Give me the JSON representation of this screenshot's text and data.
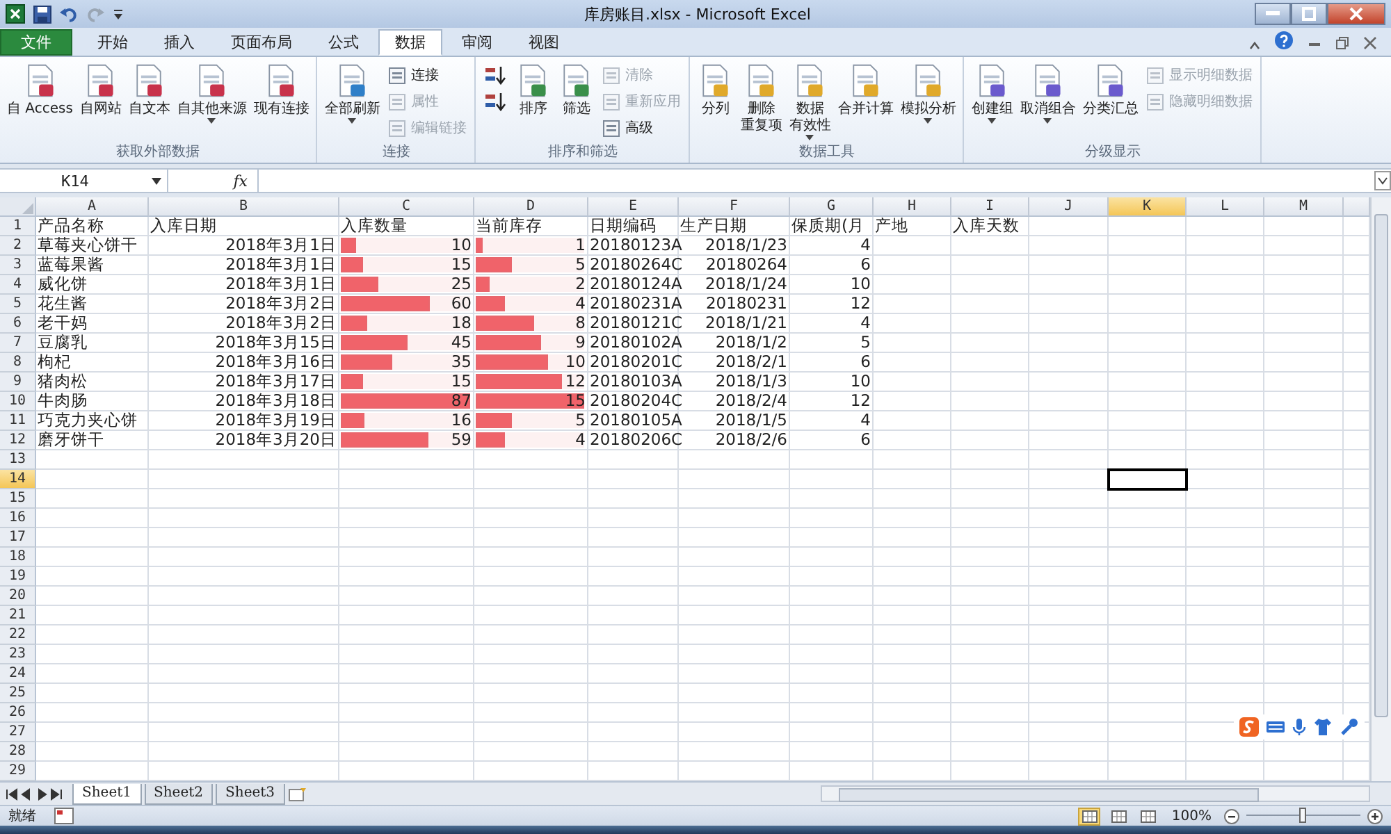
{
  "window": {
    "title": "库房账目.xlsx - Microsoft Excel"
  },
  "tabs": [
    {
      "label": "文件",
      "kind": "file",
      "selected": false
    },
    {
      "label": "开始",
      "kind": "tab",
      "selected": false
    },
    {
      "label": "插入",
      "kind": "tab",
      "selected": false
    },
    {
      "label": "页面布局",
      "kind": "tab",
      "selected": false
    },
    {
      "label": "公式",
      "kind": "tab",
      "selected": false
    },
    {
      "label": "数据",
      "kind": "tab",
      "selected": true
    },
    {
      "label": "审阅",
      "kind": "tab",
      "selected": false
    },
    {
      "label": "视图",
      "kind": "tab",
      "selected": false
    }
  ],
  "ribbon_groups": [
    {
      "label": "获取外部数据",
      "items": [
        {
          "kind": "large",
          "lines": [
            "自 Access"
          ],
          "disabled": false,
          "dropdown": false
        },
        {
          "kind": "large",
          "lines": [
            "自网站"
          ],
          "disabled": false,
          "dropdown": false
        },
        {
          "kind": "large",
          "lines": [
            "自文本"
          ],
          "disabled": false,
          "dropdown": false
        },
        {
          "kind": "large",
          "lines": [
            "自其他来源"
          ],
          "disabled": false,
          "dropdown": true
        },
        {
          "kind": "large",
          "lines": [
            "现有连接"
          ],
          "disabled": false,
          "dropdown": false
        }
      ]
    },
    {
      "label": "连接",
      "items": [
        {
          "kind": "large",
          "lines": [
            "全部刷新"
          ],
          "disabled": false,
          "dropdown": true
        },
        {
          "kind": "small",
          "lines": [
            "连接"
          ],
          "disabled": false,
          "dropdown": false
        },
        {
          "kind": "small",
          "lines": [
            "属性"
          ],
          "disabled": true,
          "dropdown": false
        },
        {
          "kind": "small",
          "lines": [
            "编辑链接"
          ],
          "disabled": true,
          "dropdown": false
        }
      ]
    },
    {
      "label": "排序和筛选",
      "items": [
        {
          "kind": "small",
          "disabled": false,
          "dropdown": false
        },
        {
          "kind": "small",
          "disabled": false,
          "dropdown": false
        },
        {
          "kind": "large",
          "lines": [
            "排序"
          ],
          "disabled": false,
          "dropdown": false
        },
        {
          "kind": "large",
          "lines": [
            "筛选"
          ],
          "disabled": false,
          "dropdown": false
        },
        {
          "kind": "small",
          "lines": [
            "清除"
          ],
          "disabled": true,
          "dropdown": false
        },
        {
          "kind": "small",
          "lines": [
            "重新应用"
          ],
          "disabled": true,
          "dropdown": false
        },
        {
          "kind": "small",
          "lines": [
            "高级"
          ],
          "disabled": false,
          "dropdown": false
        }
      ]
    },
    {
      "label": "数据工具",
      "items": [
        {
          "kind": "large",
          "lines": [
            "分列"
          ],
          "disabled": false,
          "dropdown": false
        },
        {
          "kind": "large",
          "lines": [
            "删除",
            "重复项"
          ],
          "disabled": false,
          "dropdown": false
        },
        {
          "kind": "large",
          "lines": [
            "数据",
            "有效性"
          ],
          "disabled": false,
          "dropdown": true
        },
        {
          "kind": "large",
          "lines": [
            "合并计算"
          ],
          "disabled": false,
          "dropdown": false
        },
        {
          "kind": "large",
          "lines": [
            "模拟分析"
          ],
          "disabled": false,
          "dropdown": true
        }
      ]
    },
    {
      "label": "分级显示",
      "items": [
        {
          "kind": "large",
          "lines": [
            "创建组"
          ],
          "disabled": false,
          "dropdown": true
        },
        {
          "kind": "large",
          "lines": [
            "取消组合"
          ],
          "disabled": false,
          "dropdown": true
        },
        {
          "kind": "large",
          "lines": [
            "分类汇总"
          ],
          "disabled": false,
          "dropdown": false
        },
        {
          "kind": "small",
          "lines": [
            "显示明细数据"
          ],
          "disabled": true,
          "dropdown": false
        },
        {
          "kind": "small",
          "lines": [
            "隐藏明细数据"
          ],
          "disabled": true,
          "dropdown": false
        }
      ]
    }
  ],
  "name_box": "K14",
  "formula_label": "fx",
  "columns": [
    {
      "label": "A",
      "selected": false
    },
    {
      "label": "B",
      "selected": false
    },
    {
      "label": "C",
      "selected": false
    },
    {
      "label": "D",
      "selected": false
    },
    {
      "label": "E",
      "selected": false
    },
    {
      "label": "F",
      "selected": false
    },
    {
      "label": "G",
      "selected": false
    },
    {
      "label": "H",
      "selected": false
    },
    {
      "label": "I",
      "selected": false
    },
    {
      "label": "J",
      "selected": false
    },
    {
      "label": "K",
      "selected": true
    },
    {
      "label": "L",
      "selected": false
    },
    {
      "label": "M",
      "selected": false
    }
  ],
  "rows": [
    {
      "number": "1",
      "selected": false,
      "cells": [
        {
          "kind": "text",
          "text": "产品名称"
        },
        {
          "kind": "text",
          "text": "入库日期"
        },
        {
          "kind": "text",
          "text": "入库数量"
        },
        {
          "kind": "text",
          "text": "当前库存"
        },
        {
          "kind": "text",
          "text": "日期编码"
        },
        {
          "kind": "text",
          "text": "生产日期"
        },
        {
          "kind": "text",
          "text": "保质期(月"
        },
        {
          "kind": "text",
          "text": "产地"
        },
        {
          "kind": "text",
          "text": "入库天数"
        }
      ]
    },
    {
      "number": "2",
      "selected": false,
      "cells": [
        {
          "kind": "text",
          "text": "草莓夹心饼干"
        },
        {
          "kind": "number",
          "text": "2018年3月1日"
        },
        {
          "kind": "bar",
          "text": "10",
          "level": 0.115
        },
        {
          "kind": "bar",
          "text": "1",
          "level": 0.067
        },
        {
          "kind": "text",
          "text": "20180123A"
        },
        {
          "kind": "number",
          "text": "2018/1/23"
        },
        {
          "kind": "number",
          "text": "4"
        }
      ]
    },
    {
      "number": "3",
      "selected": false,
      "cells": [
        {
          "kind": "text",
          "text": "蓝莓果酱"
        },
        {
          "kind": "number",
          "text": "2018年3月1日"
        },
        {
          "kind": "bar",
          "text": "15",
          "level": 0.172
        },
        {
          "kind": "bar",
          "text": "5",
          "level": 0.333
        },
        {
          "kind": "text",
          "text": "20180264C"
        },
        {
          "kind": "number",
          "text": "20180264"
        },
        {
          "kind": "number",
          "text": "6"
        }
      ]
    },
    {
      "number": "4",
      "selected": false,
      "cells": [
        {
          "kind": "text",
          "text": "威化饼"
        },
        {
          "kind": "number",
          "text": "2018年3月1日"
        },
        {
          "kind": "bar",
          "text": "25",
          "level": 0.287
        },
        {
          "kind": "bar",
          "text": "2",
          "level": 0.133
        },
        {
          "kind": "text",
          "text": "20180124A"
        },
        {
          "kind": "number",
          "text": "2018/1/24"
        },
        {
          "kind": "number",
          "text": "10"
        }
      ]
    },
    {
      "number": "5",
      "selected": false,
      "cells": [
        {
          "kind": "text",
          "text": "花生酱"
        },
        {
          "kind": "number",
          "text": "2018年3月2日"
        },
        {
          "kind": "bar",
          "text": "60",
          "level": 0.69
        },
        {
          "kind": "bar",
          "text": "4",
          "level": 0.267
        },
        {
          "kind": "text",
          "text": "20180231A"
        },
        {
          "kind": "number",
          "text": "20180231"
        },
        {
          "kind": "number",
          "text": "12"
        }
      ]
    },
    {
      "number": "6",
      "selected": false,
      "cells": [
        {
          "kind": "text",
          "text": "老干妈"
        },
        {
          "kind": "number",
          "text": "2018年3月2日"
        },
        {
          "kind": "bar",
          "text": "18",
          "level": 0.207
        },
        {
          "kind": "bar",
          "text": "8",
          "level": 0.533
        },
        {
          "kind": "text",
          "text": "20180121C"
        },
        {
          "kind": "number",
          "text": "2018/1/21"
        },
        {
          "kind": "number",
          "text": "4"
        }
      ]
    },
    {
      "number": "7",
      "selected": false,
      "cells": [
        {
          "kind": "text",
          "text": "豆腐乳"
        },
        {
          "kind": "number",
          "text": "2018年3月15日"
        },
        {
          "kind": "bar",
          "text": "45",
          "level": 0.517
        },
        {
          "kind": "bar",
          "text": "9",
          "level": 0.6
        },
        {
          "kind": "text",
          "text": "20180102A"
        },
        {
          "kind": "number",
          "text": "2018/1/2"
        },
        {
          "kind": "number",
          "text": "5"
        }
      ]
    },
    {
      "number": "8",
      "selected": false,
      "cells": [
        {
          "kind": "text",
          "text": "枸杞"
        },
        {
          "kind": "number",
          "text": "2018年3月16日"
        },
        {
          "kind": "bar",
          "text": "35",
          "level": 0.402
        },
        {
          "kind": "bar",
          "text": "10",
          "level": 0.667
        },
        {
          "kind": "text",
          "text": "20180201C"
        },
        {
          "kind": "number",
          "text": "2018/2/1"
        },
        {
          "kind": "number",
          "text": "6"
        }
      ]
    },
    {
      "number": "9",
      "selected": false,
      "cells": [
        {
          "kind": "text",
          "text": "猪肉松"
        },
        {
          "kind": "number",
          "text": "2018年3月17日"
        },
        {
          "kind": "bar",
          "text": "15",
          "level": 0.172
        },
        {
          "kind": "bar",
          "text": "12",
          "level": 0.8
        },
        {
          "kind": "text",
          "text": "20180103A"
        },
        {
          "kind": "number",
          "text": "2018/1/3"
        },
        {
          "kind": "number",
          "text": "10"
        }
      ]
    },
    {
      "number": "10",
      "selected": false,
      "cells": [
        {
          "kind": "text",
          "text": "牛肉肠"
        },
        {
          "kind": "number",
          "text": "2018年3月18日"
        },
        {
          "kind": "bar",
          "text": "87",
          "level": 1
        },
        {
          "kind": "bar",
          "text": "15",
          "level": 1
        },
        {
          "kind": "text",
          "text": "20180204C"
        },
        {
          "kind": "number",
          "text": "2018/2/4"
        },
        {
          "kind": "number",
          "text": "12"
        }
      ]
    },
    {
      "number": "11",
      "selected": false,
      "cells": [
        {
          "kind": "text",
          "text": "巧克力夹心饼"
        },
        {
          "kind": "number",
          "text": "2018年3月19日"
        },
        {
          "kind": "bar",
          "text": "16",
          "level": 0.184
        },
        {
          "kind": "bar",
          "text": "5",
          "level": 0.333
        },
        {
          "kind": "text",
          "text": "20180105A"
        },
        {
          "kind": "number",
          "text": "2018/1/5"
        },
        {
          "kind": "number",
          "text": "4"
        }
      ]
    },
    {
      "number": "12",
      "selected": false,
      "cells": [
        {
          "kind": "text",
          "text": "磨牙饼干"
        },
        {
          "kind": "number",
          "text": "2018年3月20日"
        },
        {
          "kind": "bar",
          "text": "59",
          "level": 0.678
        },
        {
          "kind": "bar",
          "text": "4",
          "level": 0.267
        },
        {
          "kind": "text",
          "text": "20180206C"
        },
        {
          "kind": "number",
          "text": "2018/2/6"
        },
        {
          "kind": "number",
          "text": "6"
        }
      ]
    },
    {
      "number": "13",
      "selected": false
    },
    {
      "number": "14",
      "selected": true
    },
    {
      "number": "15",
      "selected": false
    },
    {
      "number": "16",
      "selected": false
    },
    {
      "number": "17",
      "selected": false
    },
    {
      "number": "18",
      "selected": false
    },
    {
      "number": "19",
      "selected": false
    },
    {
      "number": "20",
      "selected": false
    },
    {
      "number": "21",
      "selected": false
    },
    {
      "number": "22",
      "selected": false
    },
    {
      "number": "23",
      "selected": false
    },
    {
      "number": "24",
      "selected": false
    },
    {
      "number": "25",
      "selected": false
    },
    {
      "number": "26",
      "selected": false
    },
    {
      "number": "27",
      "selected": false
    },
    {
      "number": "28",
      "selected": false
    },
    {
      "number": "29",
      "selected": false
    }
  ],
  "sheets": [
    {
      "label": "Sheet1",
      "selected": true
    },
    {
      "label": "Sheet2",
      "selected": false
    },
    {
      "label": "Sheet3",
      "selected": false
    }
  ],
  "status_bar": {
    "status": "就绪",
    "views": [
      {
        "selected": true
      },
      {
        "selected": false
      },
      {
        "selected": false
      }
    ],
    "zoom": "100%",
    "zoom_slider": {
      "level": 0.5
    }
  }
}
